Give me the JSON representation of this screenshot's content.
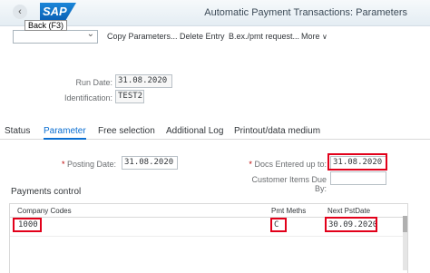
{
  "header": {
    "logo_text": "SAP",
    "title": "Automatic Payment Transactions: Parameters",
    "back_tooltip": "Back   (F3)"
  },
  "toolbar": {
    "copy_parameters": "Copy Parameters...",
    "delete_entry": "Delete Entry",
    "bex_pmt": "B.ex./pmt request...",
    "more": "More",
    "more_chevron": "∨"
  },
  "run": {
    "run_date_label": "Run Date:",
    "run_date": "31.08.2020",
    "identification_label": "Identification:",
    "identification": "TEST2"
  },
  "tabs": [
    "Status",
    "Parameter",
    "Free selection",
    "Additional Log",
    "Printout/data medium"
  ],
  "parameters": {
    "posting_date_label": "Posting Date:",
    "posting_date": "31.08.2020",
    "docs_entered_label": "Docs Entered up to:",
    "docs_entered": "31.08.2020",
    "customer_items_label": "Customer Items Due By:",
    "customer_items": "",
    "required_mark": "*"
  },
  "payments_control": {
    "title": "Payments control",
    "columns": [
      "Company Codes",
      "Pmt Meths",
      "Next PstDate"
    ],
    "rows": [
      {
        "company_codes": "1000",
        "pmt_meths": "C",
        "next_pst_date": "30.09.2020"
      }
    ]
  },
  "colors": {
    "accent": "#0a6ed1",
    "highlight": "#e2001a"
  }
}
